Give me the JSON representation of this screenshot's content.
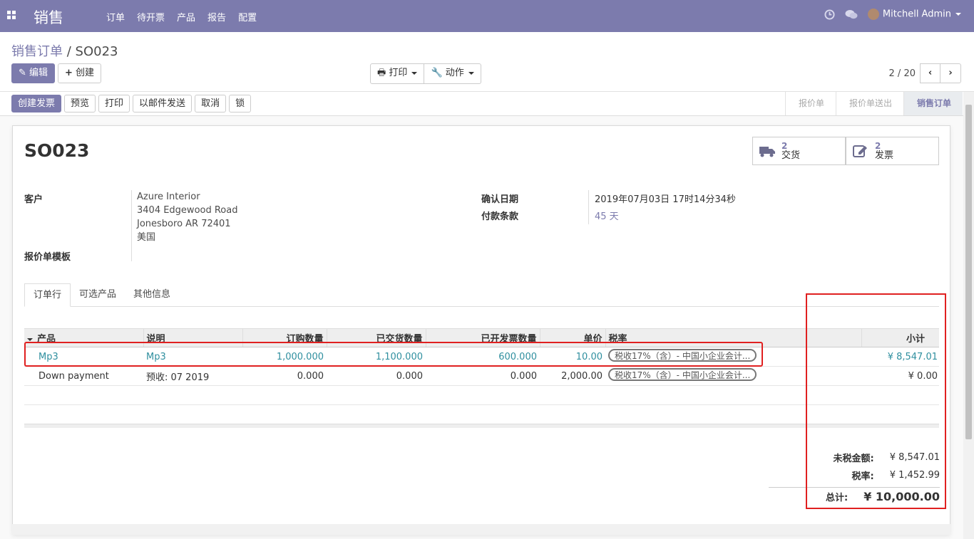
{
  "nav": {
    "brand": "销售",
    "menu": [
      "订单",
      "待开票",
      "产品",
      "报告",
      "配置"
    ],
    "user": "Mitchell Admin"
  },
  "breadcrumb": {
    "parent": "销售订单",
    "separator": "/",
    "current": "SO023"
  },
  "buttons": {
    "edit": "编辑",
    "create": "创建",
    "print": "打印",
    "action": "动作"
  },
  "pager": {
    "value": "2 / 20"
  },
  "status_actions": [
    "创建发票",
    "预览",
    "打印",
    "以邮件发送",
    "取消",
    "锁"
  ],
  "stages": [
    "报价单",
    "报价单送出",
    "销售订单"
  ],
  "active_stage": "销售订单",
  "record": {
    "name": "SO023",
    "smart_buttons": [
      {
        "count": "2",
        "label": "交货",
        "icon": "truck-icon"
      },
      {
        "count": "2",
        "label": "发票",
        "icon": "pencil-square-icon"
      }
    ],
    "customer_label": "客户",
    "customer": [
      "Azure Interior",
      "3404 Edgewood Road",
      "Jonesboro AR 72401",
      "美国"
    ],
    "template_label": "报价单模板",
    "confirm_label": "确认日期",
    "confirm_value": "2019年07月03日 17时14分34秒",
    "terms_label": "付款条款",
    "terms_value": "45 天"
  },
  "tabs": [
    "订单行",
    "可选产品",
    "其他信息"
  ],
  "table": {
    "headers": [
      "产品",
      "说明",
      "订购数量",
      "已交货数量",
      "已开发票数量",
      "单价",
      "税率",
      "小计"
    ],
    "rows": [
      [
        "Mp3",
        "Mp3",
        "1,000.000",
        "1,100.000",
        "600.000",
        "10.00",
        "税收17%（含）- 中国小企业会计...",
        "¥ 8,547.01"
      ],
      [
        "Down payment",
        "预收: 07 2019",
        "0.000",
        "0.000",
        "0.000",
        "2,000.00",
        "税收17%（含）- 中国小企业会计...",
        "¥ 0.00"
      ]
    ]
  },
  "totals": {
    "untaxed_label": "未税金额:",
    "untaxed": "¥ 8,547.01",
    "tax_label": "税率:",
    "tax": "¥ 1,452.99",
    "total_label": "总计:",
    "total": "¥ 10,000.00"
  },
  "annotation_color": "#e02020",
  "accent_color": "#7c7bad"
}
